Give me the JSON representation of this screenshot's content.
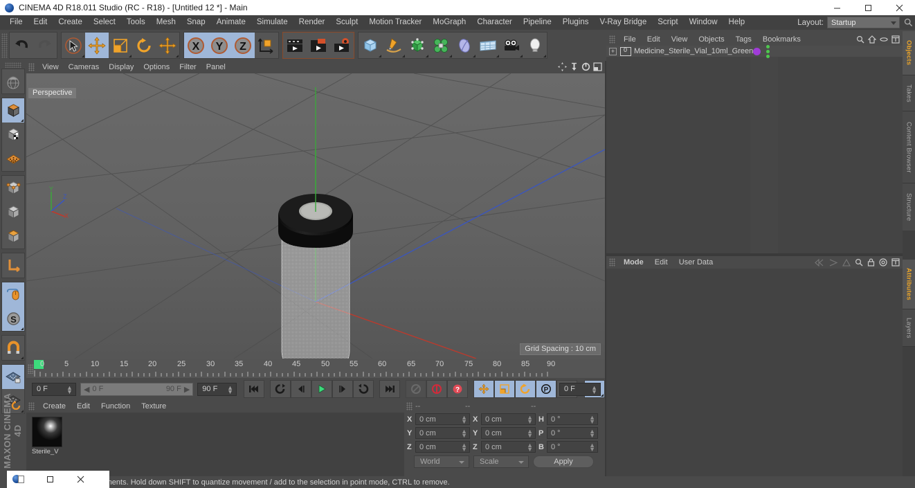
{
  "window": {
    "title": "CINEMA 4D R18.011 Studio (RC - R18) - [Untitled 12 *] - Main",
    "app_icon": "c4d-logo-icon",
    "minimize": "minimize-button",
    "maximize": "maximize-button",
    "close": "close-button"
  },
  "menubar": {
    "items": [
      "File",
      "Edit",
      "Create",
      "Select",
      "Tools",
      "Mesh",
      "Snap",
      "Animate",
      "Simulate",
      "Render",
      "Sculpt",
      "Motion Tracker",
      "MoGraph",
      "Character",
      "Pipeline",
      "Plugins",
      "V-Ray Bridge",
      "Script",
      "Window",
      "Help"
    ],
    "layout_label": "Layout:",
    "layout_value": "Startup",
    "search_icon": "search-icon"
  },
  "toolbar": {
    "groups": [
      {
        "name": "history",
        "buttons": [
          {
            "icon": "undo-icon",
            "label": "Undo",
            "state": "normal"
          },
          {
            "icon": "redo-icon",
            "label": "Redo",
            "state": "disabled"
          }
        ]
      },
      {
        "name": "tools",
        "buttons": [
          {
            "icon": "live-selection-icon",
            "label": "Live Selection",
            "state": "normal"
          },
          {
            "icon": "move-icon",
            "label": "Move",
            "state": "selected"
          },
          {
            "icon": "scale-icon",
            "label": "Scale",
            "state": "normal"
          },
          {
            "icon": "rotate-icon",
            "label": "Rotate",
            "state": "normal"
          },
          {
            "icon": "move-alt-icon",
            "label": "Move Tool",
            "state": "normal"
          }
        ]
      },
      {
        "name": "axis-locks",
        "buttons": [
          {
            "icon": "x-axis-icon",
            "label": "X Axis",
            "state": "selected"
          },
          {
            "icon": "y-axis-icon",
            "label": "Y Axis",
            "state": "selected"
          },
          {
            "icon": "z-axis-icon",
            "label": "Z Axis",
            "state": "selected"
          },
          {
            "icon": "world-object-axis-icon",
            "label": "World/Object Coordinate System",
            "state": "normal"
          }
        ]
      },
      {
        "name": "render",
        "buttons": [
          {
            "icon": "render-view-icon",
            "label": "Render View",
            "state": "normal"
          },
          {
            "icon": "render-region-icon",
            "label": "Render to Picture Viewer",
            "state": "normal"
          },
          {
            "icon": "render-settings-icon",
            "label": "Edit Render Settings",
            "state": "normal"
          }
        ]
      },
      {
        "name": "objects",
        "buttons": [
          {
            "icon": "cube-primitive-icon",
            "label": "Add Cube Object",
            "state": "normal"
          },
          {
            "icon": "spline-pen-icon",
            "label": "Add Spline",
            "state": "normal"
          },
          {
            "icon": "generator-icon",
            "label": "Add Generator",
            "state": "normal"
          },
          {
            "icon": "deformer-icon",
            "label": "Add Deformer",
            "state": "normal"
          },
          {
            "icon": "scene-object-icon",
            "label": "Add Scene Object",
            "state": "normal"
          },
          {
            "icon": "environment-icon",
            "label": "Add Environment",
            "state": "normal"
          },
          {
            "icon": "camera-icon",
            "label": "Add Camera",
            "state": "normal"
          },
          {
            "icon": "light-icon",
            "label": "Add Light",
            "state": "normal"
          }
        ]
      }
    ]
  },
  "left_toolbar": {
    "buttons": [
      {
        "icon": "viewport-globe-icon",
        "label": "Make Editable",
        "state": "normal"
      },
      {
        "icon": "model-mode-icon",
        "label": "Model Mode",
        "state": "selected"
      },
      {
        "icon": "texture-mode-icon",
        "label": "Texture Mode",
        "state": "normal"
      },
      {
        "icon": "points-mode-icon",
        "label": "Points Mode",
        "state": "normal"
      },
      {
        "icon": "edges-mode-icon",
        "label": "Edges Mode",
        "state": "normal"
      },
      {
        "icon": "polygons-mode-icon",
        "label": "Polygons Mode",
        "state": "normal"
      },
      {
        "icon": "axis-mode-icon",
        "label": "Enable Axis Modification",
        "state": "normal"
      },
      {
        "icon": "world-axis-icon",
        "label": "World/Object Axis",
        "state": "normal"
      },
      {
        "icon": "viewport-solo-icon",
        "label": "Viewport Solo",
        "state": "selected"
      },
      {
        "icon": "solo-single-icon",
        "label": "Viewport Solo Single",
        "state": "selected"
      },
      {
        "icon": "magnet-icon",
        "label": "Magnet",
        "state": "normal"
      },
      {
        "icon": "workplane-lock-icon",
        "label": "Lock Workplane",
        "state": "selected"
      },
      {
        "icon": "workplane-rotate-icon",
        "label": "Planar Workplane Rotation",
        "state": "normal"
      }
    ],
    "brand_line1": "MAXON",
    "brand_line2": "CINEMA 4D"
  },
  "viewport": {
    "menus": [
      "View",
      "Cameras",
      "Display",
      "Options",
      "Filter",
      "Panel"
    ],
    "corner_icons": [
      "pan-view-icon",
      "dolly-view-icon",
      "rotate-view-icon",
      "maximize-view-icon"
    ],
    "label": "Perspective",
    "grid_spacing": "Grid Spacing : 10 cm",
    "axis_gizmo": {
      "x": "X",
      "y": "Y",
      "z": "Z"
    }
  },
  "timeline": {
    "ruler_numbers": [
      "0",
      "5",
      "10",
      "15",
      "20",
      "25",
      "30",
      "35",
      "40",
      "45",
      "50",
      "55",
      "60",
      "65",
      "70",
      "75",
      "80",
      "85",
      "90"
    ],
    "current_frame": "0 F",
    "range_start": "0 F",
    "range_end": "90 F",
    "max_frame": "90 F",
    "right_frame": "0 F",
    "buttons": [
      {
        "icon": "go-to-start-icon",
        "label": "Go to Start",
        "state": "normal"
      },
      {
        "icon": "play-backwards-loop-icon",
        "label": "Play Backwards",
        "state": "normal"
      },
      {
        "icon": "step-back-icon",
        "label": "Go to Previous Frame",
        "state": "normal"
      },
      {
        "icon": "play-forward-icon",
        "label": "Play Forward",
        "state": "normal"
      },
      {
        "icon": "step-forward-icon",
        "label": "Go to Next Frame",
        "state": "normal"
      },
      {
        "icon": "loop-icon",
        "label": "Go to End",
        "state": "normal"
      },
      {
        "icon": "go-to-end-icon",
        "label": "Go to End",
        "state": "normal"
      },
      {
        "icon": "record-active-objects-icon",
        "label": "Record Active Objects",
        "state": "disabled"
      },
      {
        "icon": "autokeying-icon",
        "label": "Autokeying",
        "state": "normal"
      },
      {
        "icon": "keyframe-selection-icon",
        "label": "Keyframe Selection",
        "state": "normal"
      },
      {
        "icon": "position-key-icon",
        "label": "Position",
        "state": "selected"
      },
      {
        "icon": "scale-key-icon",
        "label": "Scale",
        "state": "selected"
      },
      {
        "icon": "rotation-key-icon",
        "label": "Rotation",
        "state": "selected"
      },
      {
        "icon": "parameter-key-icon",
        "label": "Parameter",
        "state": "selected"
      },
      {
        "icon": "point-level-animation-icon",
        "label": "Point Level Animation",
        "state": "normal"
      },
      {
        "icon": "timeline-layout-icon",
        "label": "Animation Layout",
        "state": "selected"
      }
    ]
  },
  "material_manager": {
    "menus": [
      "Create",
      "Edit",
      "Function",
      "Texture"
    ],
    "materials": [
      {
        "name": "Sterile_V",
        "icon": "material-sphere-icon",
        "color": "#2f8a49"
      }
    ]
  },
  "coordinates": {
    "header_position": "--",
    "header_size": "--",
    "header_rotation": "--",
    "rows": [
      {
        "pos_label": "X",
        "pos_value": "0 cm",
        "size_label": "X",
        "size_value": "0 cm",
        "rot_label": "H",
        "rot_value": "0 °"
      },
      {
        "pos_label": "Y",
        "pos_value": "0 cm",
        "size_label": "Y",
        "size_value": "0 cm",
        "rot_label": "P",
        "rot_value": "0 °"
      },
      {
        "pos_label": "Z",
        "pos_value": "0 cm",
        "size_label": "Z",
        "size_value": "0 cm",
        "rot_label": "B",
        "rot_value": "0 °"
      }
    ],
    "system_select": "World",
    "mode_select": "Scale",
    "apply_button": "Apply"
  },
  "object_manager": {
    "menus": [
      "File",
      "Edit",
      "View",
      "Objects",
      "Tags",
      "Bookmarks"
    ],
    "icons": [
      "search-icon",
      "home-icon",
      "link-icon",
      "fit-icon"
    ],
    "objects": [
      {
        "name": "Medicine_Sterile_Vial_10ml_Green",
        "expand": "+",
        "icon": "null-object-icon",
        "tag_color": "#a03cd8"
      }
    ]
  },
  "attribute_manager": {
    "menus": [
      "Mode",
      "Edit",
      "User Data"
    ],
    "nav_icons": [
      "back-icon",
      "forward-icon",
      "up-icon"
    ],
    "icons": [
      "search-icon",
      "lock-icon",
      "target-icon",
      "fit-icon"
    ]
  },
  "right_tabs": {
    "top": [
      "Objects",
      "Takes",
      "Content Browser",
      "Structure"
    ],
    "bottom": [
      "Attributes",
      "Layers"
    ],
    "active_top": "Objects",
    "active_bottom": "Attributes"
  },
  "statusbar": {
    "message": "move elements. Hold down SHIFT to quantize movement / add to the selection in point mode, CTRL to remove."
  },
  "mini_window": {
    "icon": "c4d-taskbar-icon",
    "restore": "restore-button",
    "close": "close-button"
  },
  "colors": {
    "accent_selected": "#9fb7d8",
    "tab_active_text": "#e8a32a",
    "panel_bg": "#4a4a4a",
    "viewport_bg": "#606060",
    "axis_x": "#c0392b",
    "axis_y": "#3ba83b",
    "axis_z": "#3a56c0"
  }
}
